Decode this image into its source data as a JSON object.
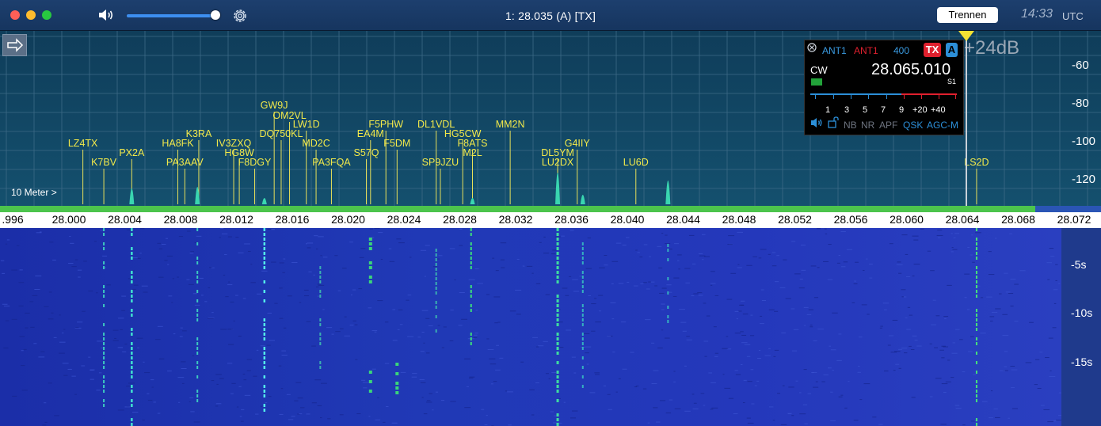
{
  "window": {
    "title": "1: 28.035  (A) [TX]",
    "disconnect_label": "Trennen",
    "clock": "14:33",
    "timezone": "UTC"
  },
  "icons": {
    "volume": "speaker-icon",
    "settings": "gear-icon",
    "arrow": "right-arrow-icon"
  },
  "spectrum": {
    "band_label": "10 Meter >",
    "db_scale": [
      "-60",
      "-80",
      "-100",
      "-120"
    ],
    "freq_labels": [
      ".996",
      "28.000",
      "28.004",
      "28.008",
      "28.012",
      "28.016",
      "28.020",
      "28.024",
      "28.028",
      "28.032",
      "28.036",
      "28.040",
      "28.044",
      "28.048",
      "28.052",
      "28.056",
      "28.060",
      "28.064",
      "28.068",
      "28.072"
    ],
    "spots": [
      {
        "call": "LZ4TX",
        "freq": "28.001"
      },
      {
        "call": "K7BV",
        "freq": "28.0025"
      },
      {
        "call": "PX2A",
        "freq": "28.0045"
      },
      {
        "call": "HA8FK",
        "freq": "28.0078"
      },
      {
        "call": "K3RA",
        "freq": "28.0093"
      },
      {
        "call": "PA3AAV",
        "freq": "28.0083"
      },
      {
        "call": "IV3ZXQ",
        "freq": "28.0118"
      },
      {
        "call": "HG8W",
        "freq": "28.0122"
      },
      {
        "call": "F8DGY",
        "freq": "28.0133"
      },
      {
        "call": "GW9J",
        "freq": "28.0147"
      },
      {
        "call": "OM2VL",
        "freq": "28.0158"
      },
      {
        "call": "DQ750KL",
        "freq": "28.0152"
      },
      {
        "call": "LW1D",
        "freq": "28.0170"
      },
      {
        "call": "MD2C",
        "freq": "28.0177"
      },
      {
        "call": "PA3FQA",
        "freq": "28.0188"
      },
      {
        "call": "S57Q",
        "freq": "28.0213"
      },
      {
        "call": "EA4M",
        "freq": "28.0216"
      },
      {
        "call": "F5PHW",
        "freq": "28.0227"
      },
      {
        "call": "F5DM",
        "freq": "28.0235"
      },
      {
        "call": "DL1VDL",
        "freq": "28.0263"
      },
      {
        "call": "SP9JZU",
        "freq": "28.0266"
      },
      {
        "call": "HG5CW",
        "freq": "28.0282"
      },
      {
        "call": "F8ATS",
        "freq": "28.0289"
      },
      {
        "call": "M2L",
        "freq": "28.0289"
      },
      {
        "call": "MM2N",
        "freq": "28.0316"
      },
      {
        "call": "DL5YM",
        "freq": "28.0350"
      },
      {
        "call": "LU2DX",
        "freq": "28.0350"
      },
      {
        "call": "G4IIY",
        "freq": "28.0364"
      },
      {
        "call": "LU6D",
        "freq": "28.0406"
      },
      {
        "call": "LS2D",
        "freq": "28.0650"
      }
    ]
  },
  "waterfall": {
    "time_labels": [
      "-5s",
      "-10s",
      "-15s"
    ]
  },
  "receiver": {
    "ant_tx": "ANT1",
    "ant_rx": "ANT1",
    "filter": "400",
    "tx_badge": "TX",
    "vfo_badge": "A",
    "gain": "+24dB",
    "mode": "CW",
    "frequency": "28.065.010",
    "s_reading": "S1",
    "meter_scale": [
      "1",
      "3",
      "5",
      "7",
      "9",
      "+20",
      "+40"
    ],
    "controls": [
      "NB",
      "NR",
      "APF",
      "QSK",
      "AGC-M"
    ],
    "colors": {
      "tx": "#e0202e",
      "vfo": "#2c8fd8",
      "meter_low": "#2c8fd8",
      "meter_high": "#e0202e"
    }
  }
}
